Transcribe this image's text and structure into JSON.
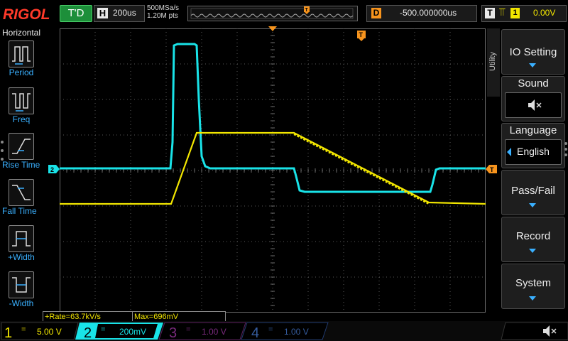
{
  "header": {
    "brand": "RIGOL",
    "run_state": "T'D",
    "timebase_label": "H",
    "timebase": "200us",
    "sample_rate": "500MSa/s",
    "memory_depth": "1.20M pts",
    "delay_label": "D",
    "trigger_delay": "-500.000000us",
    "trigger_label": "T",
    "trigger_source": "1",
    "trigger_level": "0.00V"
  },
  "left_panel": {
    "title": "Horizontal",
    "items": [
      {
        "label": "Period",
        "icon": "period-icon"
      },
      {
        "label": "Freq",
        "icon": "freq-icon"
      },
      {
        "label": "Rise Time",
        "icon": "rise-time-icon"
      },
      {
        "label": "Fall Time",
        "icon": "fall-time-icon"
      },
      {
        "label": "+Width",
        "icon": "positive-width-icon"
      },
      {
        "label": "-Width",
        "icon": "negative-width-icon"
      }
    ]
  },
  "right_menu": {
    "tab": "Utility",
    "items": [
      {
        "label": "IO Setting"
      },
      {
        "label": "Sound",
        "value_icon": "speaker-mute-icon"
      },
      {
        "label": "Language",
        "value": "English"
      },
      {
        "label": "Pass/Fail"
      },
      {
        "label": "Record"
      },
      {
        "label": "System"
      }
    ]
  },
  "markers": {
    "ch2": "2",
    "trigger": "T"
  },
  "results": {
    "rate": "+Rate=63.7kV/s",
    "max": "Max=696mV"
  },
  "channels": [
    {
      "num": "1",
      "coupling": "=",
      "scale": "5.00 V",
      "color": "#f2e600",
      "active": true
    },
    {
      "num": "2",
      "coupling": "=",
      "scale": "200mV",
      "color": "#19e3e8",
      "active": true
    },
    {
      "num": "3",
      "coupling": "=",
      "scale": "1.00 V",
      "color": "#c11bc6",
      "active": false
    },
    {
      "num": "4",
      "coupling": "=",
      "scale": "1.00 V",
      "color": "#2b66d8",
      "active": false
    }
  ],
  "colors": {
    "ch1": "#f2e600",
    "ch2": "#19e3e8",
    "trigger": "#f7941d",
    "accent": "#3ab0ff"
  }
}
